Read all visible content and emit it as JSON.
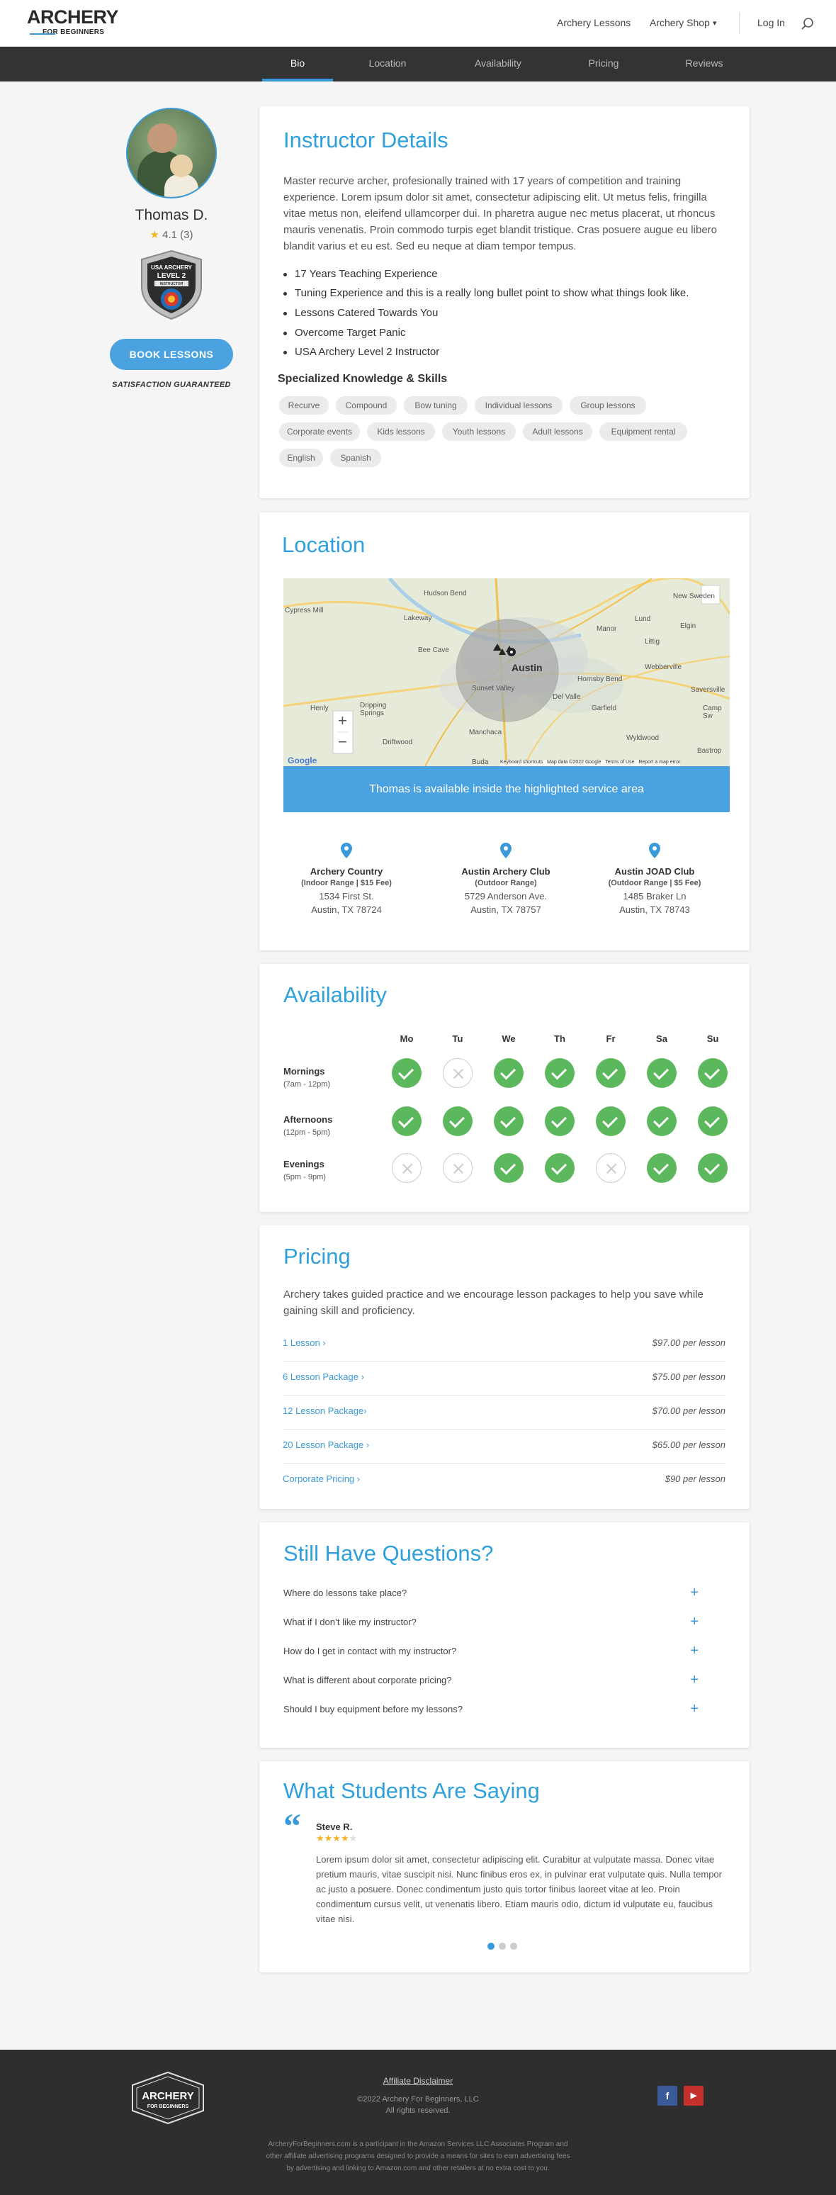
{
  "header": {
    "logo_line1": "ARCHERY",
    "logo_line2": "FOR BEGINNERS",
    "nav": [
      "Archery Lessons",
      "Archery Shop",
      "Log In"
    ],
    "shop_chevron": "▾"
  },
  "tabs": [
    "Bio",
    "Location",
    "Availability",
    "Pricing",
    "Reviews"
  ],
  "profile": {
    "name": "Thomas D.",
    "rating_star": "★",
    "rating": "4.1 (3)",
    "badge_lines": [
      "USA ARCHERY",
      "LEVEL 2",
      "INSTRUCTOR"
    ],
    "book_label": "BOOK LESSONS",
    "guarantee": "SATISFACTION GUARANTEED"
  },
  "instructor": {
    "title": "Instructor Details",
    "bio": "Master recurve archer, profesionally trained with 17 years of competition and training experience. Lorem ipsum dolor sit amet, consectetur adipiscing elit. Ut metus felis, fringilla vitae metus non, eleifend ullamcorper dui. In pharetra augue nec metus placerat, ut rhoncus mauris venenatis. Proin commodo turpis eget blandit tristique. Cras posuere augue eu libero blandit varius et eu est. Sed eu neque at diam tempor tempus.",
    "bullets": [
      "17 Years Teaching Experience",
      "Tuning Experience and this is a really long bullet point to show what things look like.",
      "Lessons Catered Towards You",
      "Overcome Target Panic",
      "USA Archery Level 2 Instructor"
    ],
    "skills_title": "Specialized Knowledge & Skills",
    "skills": [
      "Recurve",
      "Compound",
      "Bow tuning",
      "Individual lessons",
      "Group lessons",
      "Corporate events",
      "Kids lessons",
      "Youth lessons",
      "Adult lessons",
      "Equipment rental",
      "English",
      "Spanish"
    ]
  },
  "location": {
    "title": "Location",
    "map_labels": [
      "Hudson Bend",
      "Cypress Mill",
      "Lakeway",
      "Bee Cave",
      "Austin",
      "Sunset Valley",
      "Manor",
      "New Sweden",
      "Lund",
      "Littig",
      "Elgin",
      "Hornsby Bend",
      "Del Valle",
      "Garfield",
      "Webberville",
      "Saversville",
      "Camp Sw",
      "Dripping Springs",
      "Henly",
      "Driftwood",
      "Manchaca",
      "Wyldwood",
      "Buda",
      "Bastrop"
    ],
    "map_footer": [
      "Keyboard shortcuts",
      "Map data ©2022 Google",
      "Terms of Use",
      "Report a map error"
    ],
    "google": "Google",
    "zoom_in": "+",
    "zoom_out": "−",
    "banner": "Thomas is available inside the highlighted service area",
    "places": [
      {
        "name": "Archery Country",
        "sub": "(Indoor Range | $15 Fee)",
        "addr1": "1534 First St.",
        "addr2": "Austin, TX 78724"
      },
      {
        "name": "Austin Archery Club",
        "sub": "(Outdoor Range)",
        "addr1": "5729 Anderson Ave.",
        "addr2": "Austin, TX 78757"
      },
      {
        "name": "Austin JOAD Club",
        "sub": "(Outdoor Range | $5 Fee)",
        "addr1": "1485 Braker Ln",
        "addr2": "Austin, TX 78743"
      }
    ]
  },
  "availability": {
    "title": "Availability",
    "days": [
      "Mo",
      "Tu",
      "We",
      "Th",
      "Fr",
      "Sa",
      "Su"
    ],
    "slots": [
      {
        "name": "Mornings",
        "hours": "(7am - 12pm)",
        "available": [
          true,
          false,
          true,
          true,
          true,
          true,
          true
        ]
      },
      {
        "name": "Afternoons",
        "hours": "(12pm - 5pm)",
        "available": [
          true,
          true,
          true,
          true,
          true,
          true,
          true
        ]
      },
      {
        "name": "Evenings",
        "hours": "(5pm - 9pm)",
        "available": [
          false,
          false,
          true,
          true,
          false,
          true,
          true
        ]
      }
    ]
  },
  "pricing": {
    "title": "Pricing",
    "intro": "Archery takes guided practice and we encourage lesson packages to help you save while gaining skill and proficiency.",
    "items": [
      {
        "label": "1 Lesson ›",
        "price": "$97.00 per lesson"
      },
      {
        "label": "6 Lesson Package ›",
        "price": "$75.00 per lesson"
      },
      {
        "label": "12 Lesson Package›",
        "price": "$70.00 per lesson"
      },
      {
        "label": "20 Lesson Package ›",
        "price": "$65.00 per lesson"
      },
      {
        "label": "Corporate Pricing ›",
        "price": "$90 per lesson"
      }
    ]
  },
  "faq": {
    "title": "Still Have Questions?",
    "items": [
      "Where do lessons take place?",
      "What if I don’t like my instructor?",
      "How do I get in contact with my instructor?",
      "What is different about corporate pricing?",
      "Should I buy equipment before my lessons?"
    ],
    "plus": "+"
  },
  "reviews": {
    "title": "What Students Are Saying",
    "quote_mark": "“",
    "reviewer": "Steve R.",
    "stars": "★★★★",
    "stars_empty": "★",
    "rating": 4,
    "text": "Lorem ipsum dolor sit amet, consectetur adipiscing elit. Curabitur at vulputate massa. Donec vitae pretium mauris, vitae suscipit nisi. Nunc finibus eros ex, in pulvinar erat vulputate quis. Nulla tempor ac justo a posuere. Donec condimentum justo quis tortor finibus laoreet vitae at leo. Proin condimentum cursus velit, ut venenatis libero. Etiam mauris odio, dictum id vulputate eu, faucibus vitae nisi."
  },
  "footer": {
    "logo_line1": "ARCHERY",
    "logo_line2": "FOR BEGINNERS",
    "disclaimer": "Affiliate Disclaimer",
    "copyright": "©2022 Archery For Beginners, LLC",
    "rights": "All rights reserved.",
    "amazon": [
      "ArcheryForBeginners.com is a participant in the Amazon Services LLC Associates Program and",
      "other affiliate advertising programs designed to provide a means for sites to earn advertising fees",
      "by advertising and linking to Amazon.com and other retailers at no extra cost to you."
    ],
    "facebook": "f",
    "youtube": "▶"
  },
  "colors": {
    "accent": "#3a9ad9",
    "heading": "#2fa0dc",
    "available": "#5cb85c",
    "footer_bg": "#2e2e2e",
    "tabs_bg": "#333333"
  }
}
